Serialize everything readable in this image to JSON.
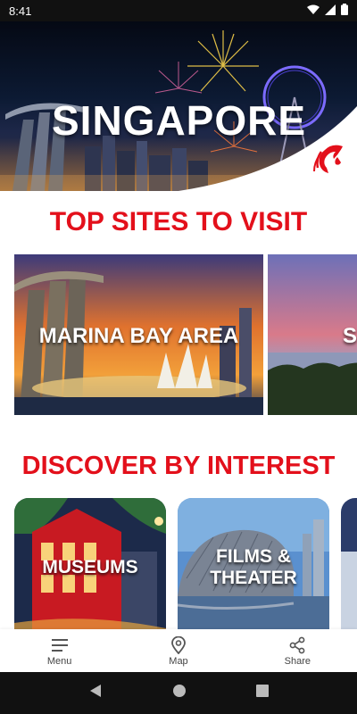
{
  "status_bar": {
    "time": "8:41"
  },
  "hero": {
    "title": "SINGAPORE"
  },
  "top_sites": {
    "heading": "TOP SITES TO VISIT",
    "items": [
      {
        "label": "MARINA BAY AREA"
      },
      {
        "label": "S"
      }
    ]
  },
  "interests": {
    "heading": "DISCOVER BY INTEREST",
    "items": [
      {
        "label": "MUSEUMS"
      },
      {
        "label_line1": "FILMS &",
        "label_line2": "THEATER"
      }
    ]
  },
  "bottom_nav": {
    "items": [
      {
        "label": "Menu",
        "icon": "menu-icon"
      },
      {
        "label": "Map",
        "icon": "map-pin-icon"
      },
      {
        "label": "Share",
        "icon": "share-icon"
      }
    ]
  },
  "colors": {
    "accent": "#e3101b"
  }
}
